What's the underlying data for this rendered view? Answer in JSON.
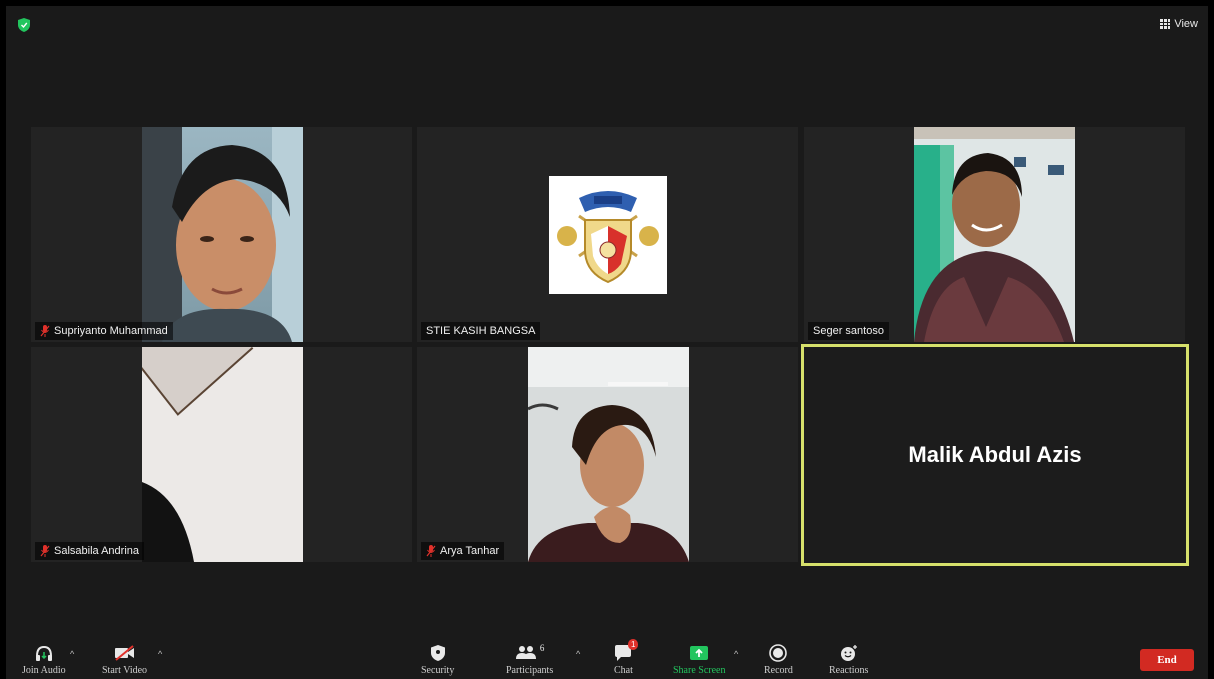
{
  "topbar": {
    "view_label": "View"
  },
  "tiles": [
    {
      "name": "Supriyanto Muhammad",
      "muted": true
    },
    {
      "name": "STIE KASIH BANGSA",
      "muted": false
    },
    {
      "name": "Seger santoso",
      "muted": false
    },
    {
      "name": "Salsabila Andrina",
      "muted": true
    },
    {
      "name": "Arya Tanhar",
      "muted": true
    },
    {
      "name": "Malik Abdul Azis",
      "active": true
    }
  ],
  "toolbar": {
    "join_audio": "Join Audio",
    "start_video": "Start Video",
    "security": "Security",
    "participants": "Participants",
    "participants_count": "6",
    "chat": "Chat",
    "chat_badge": "1",
    "share_screen": "Share Screen",
    "record": "Record",
    "reactions": "Reactions",
    "end": "End"
  },
  "colors": {
    "active_border": "#d6e06b",
    "end_button": "#d22a22",
    "share_green": "#22c55e",
    "muted_red": "#e0312b"
  }
}
